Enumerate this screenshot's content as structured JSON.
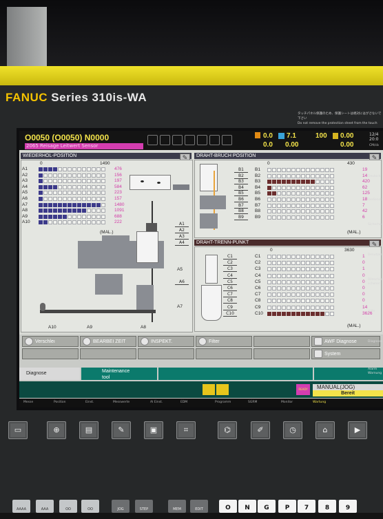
{
  "brand": {
    "name": "FANUC",
    "series": "Series 310is-WA"
  },
  "notice": {
    "line1": "タッチパネル保護のため、保護シートは絶対にはがさないで下さい",
    "line2": "Do not remove the protection sheet from the touch"
  },
  "header": {
    "program": "O0050",
    "program_paren": "(O0050)",
    "block": "N0000",
    "sub": "2065 Reisage Leitwert Sensor",
    "readout1": "0.0",
    "readout2": "0.0",
    "readout3": "7.1",
    "readout4": "0.00",
    "readout5": "100",
    "readout6": "0.00",
    "readout7": "0.00",
    "clock": "12/4 20:0",
    "unit_right": "CM/cb"
  },
  "panels": {
    "wiederhol": {
      "title": "WIEDERHOL-POSITION",
      "scale_min": "0",
      "scale_max": "1490",
      "rows": [
        {
          "label": "A1",
          "value": "476",
          "fill": 4
        },
        {
          "label": "A2",
          "value": "156",
          "fill": 1
        },
        {
          "label": "A3",
          "value": "197",
          "fill": 1
        },
        {
          "label": "A4",
          "value": "584",
          "fill": 4
        },
        {
          "label": "A5",
          "value": "223",
          "fill": 1
        },
        {
          "label": "A6",
          "value": "157",
          "fill": 1
        },
        {
          "label": "A7",
          "value": "1480",
          "fill": 13
        },
        {
          "label": "A8",
          "value": "1091",
          "fill": 10
        },
        {
          "label": "A9",
          "value": "688",
          "fill": 6
        },
        {
          "label": "A10",
          "value": "222",
          "fill": 2
        }
      ],
      "mal": "(MAL.)",
      "zones": [
        "A1",
        "A2",
        "A3",
        "A4",
        "A5",
        "A6",
        "A7",
        "A8",
        "A9",
        "A10"
      ]
    },
    "bruch": {
      "title": "DRAHT-BRUCH POSITION",
      "scale_min": "0",
      "scale_max": "430",
      "rows": [
        {
          "label": "B1",
          "value": "19",
          "fill": 0
        },
        {
          "label": "B2",
          "value": "14",
          "fill": 0
        },
        {
          "label": "B3",
          "value": "420",
          "fill": 10
        },
        {
          "label": "B4",
          "value": "62",
          "fill": 1
        },
        {
          "label": "B5",
          "value": "125",
          "fill": 2
        },
        {
          "label": "B6",
          "value": "18",
          "fill": 0
        },
        {
          "label": "B7",
          "value": "7",
          "fill": 0
        },
        {
          "label": "B8",
          "value": "42",
          "fill": 0
        },
        {
          "label": "B9",
          "value": "6",
          "fill": 0
        }
      ],
      "mal": "(MAL.)"
    },
    "trenn": {
      "title": "DRAHT-TRENN-PUNKT",
      "scale_min": "0",
      "scale_max": "3630",
      "rows": [
        {
          "label": "C1",
          "value": "1",
          "fill": 0
        },
        {
          "label": "C2",
          "value": "0",
          "fill": 0
        },
        {
          "label": "C3",
          "value": "1",
          "fill": 0
        },
        {
          "label": "C4",
          "value": "0",
          "fill": 0
        },
        {
          "label": "C5",
          "value": "0",
          "fill": 0
        },
        {
          "label": "C6",
          "value": "0",
          "fill": 0
        },
        {
          "label": "C7",
          "value": "0",
          "fill": 0
        },
        {
          "label": "C8",
          "value": "0",
          "fill": 0
        },
        {
          "label": "C9",
          "value": "14",
          "fill": 0
        },
        {
          "label": "C10",
          "value": "3626",
          "fill": 12
        }
      ],
      "mal": "(MAL.)"
    }
  },
  "softkeys": {
    "row1": [
      "Verschleı",
      "BEARBEI ZEIT",
      "INSPEKT.",
      "Filter",
      "",
      "AWF Diagnose"
    ],
    "row2": [
      "",
      "",
      "",
      "",
      "",
      "System"
    ]
  },
  "tabs": {
    "diagnose": "Diagnose",
    "maintenance_1": "Maintenance",
    "maintenance_2": "tool"
  },
  "mode": {
    "line1": "MANUAL(JOG)",
    "line2": "Bereit",
    "ready_badge": "READY"
  },
  "side_labels": [
    "Deutsch",
    "Bediensteuer",
    "Sicherheitsstop",
    "Benutzer",
    "Bildschirm schoner",
    "Hilfe",
    "Diagnose",
    "Alarm Warnung",
    "Ext"
  ],
  "function_bar": [
    "Messe",
    "Position",
    "Einst.",
    "Messwerte",
    "AI Einst.",
    "EDM",
    "Programm",
    "SGRM",
    "Monitor",
    "Wartung"
  ],
  "bottom_keys": [
    "AAAA",
    "AAA",
    "OO",
    "OO",
    "JOG",
    "STEP",
    "MEM",
    "EDIT",
    "O",
    "N",
    "G",
    "P",
    "7",
    "8",
    "9"
  ],
  "colors": {
    "accent_yellow": "#f3e34a",
    "magenta": "#d43db0",
    "teal": "#0b7a6c",
    "value_pink": "#d23aa7"
  }
}
